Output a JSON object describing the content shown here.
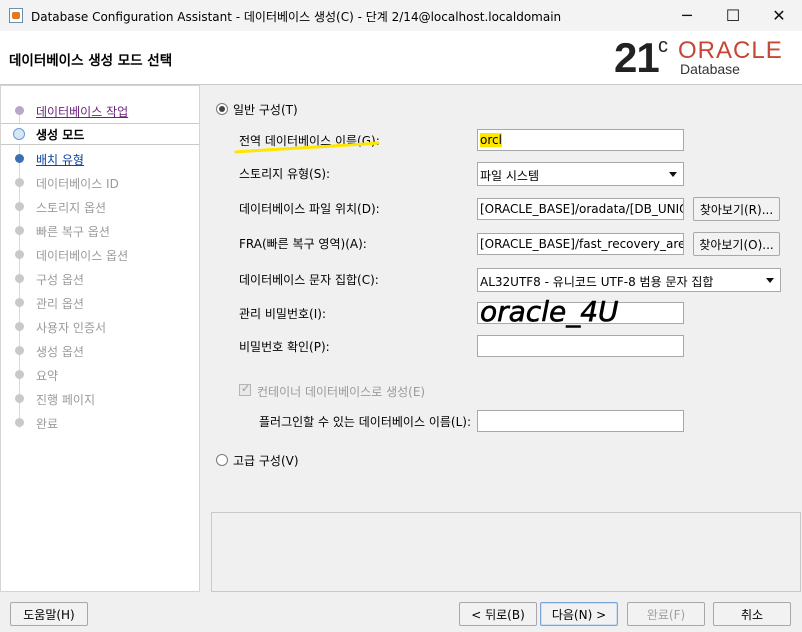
{
  "window": {
    "title": "Database Configuration Assistant - 데이터베이스 생성(C) - 단계 2/14@localhost.localdomain",
    "minimize_glyph": "─",
    "maximize_glyph": "☐",
    "close_glyph": "✕"
  },
  "header": {
    "title": "데이터베이스 생성 모드 선택",
    "logo_version": "21",
    "logo_suffix": "c",
    "logo_brand": "ORACLE",
    "logo_product": "Database"
  },
  "sidebar": {
    "steps": [
      {
        "label": "데이터베이스 작업",
        "state": "done"
      },
      {
        "label": "생성 모드",
        "state": "current"
      },
      {
        "label": "배치 유형",
        "state": "link"
      },
      {
        "label": "데이터베이스 ID",
        "state": "disabled"
      },
      {
        "label": "스토리지 옵션",
        "state": "disabled"
      },
      {
        "label": "빠른 복구 옵션",
        "state": "disabled"
      },
      {
        "label": "데이터베이스 옵션",
        "state": "disabled"
      },
      {
        "label": "구성 옵션",
        "state": "disabled"
      },
      {
        "label": "관리 옵션",
        "state": "disabled"
      },
      {
        "label": "사용자 인증서",
        "state": "disabled"
      },
      {
        "label": "생성 옵션",
        "state": "disabled"
      },
      {
        "label": "요약",
        "state": "disabled"
      },
      {
        "label": "진행 페이지",
        "state": "disabled"
      },
      {
        "label": "완료",
        "state": "disabled"
      }
    ]
  },
  "form": {
    "typical_label": "일반 구성(T)",
    "global_db_name_label": "전역 데이터베이스 이름(G):",
    "global_db_name_value": "orcl",
    "storage_type_label": "스토리지 유형(S):",
    "storage_type_value": "파일 시스템",
    "db_file_location_label": "데이터베이스 파일 위치(D):",
    "db_file_location_value": "[ORACLE_BASE]/oradata/[DB_UNIQUE_NAME]",
    "browse_db_label": "찾아보기(R)...",
    "fra_label": "FRA(빠른 복구 영역)(A):",
    "fra_value": "[ORACLE_BASE]/fast_recovery_area/[DB_UNIQUE_NAME]",
    "browse_fra_label": "찾아보기(O)...",
    "charset_label": "데이터베이스 문자 집합(C):",
    "charset_value": "AL32UTF8 - 유니코드 UTF-8 범용 문자 집합",
    "admin_password_label": "관리 비밀번호(I):",
    "admin_password_annotation": "oracle_4U",
    "confirm_password_label": "비밀번호 확인(P):",
    "container_db_label": "컨테이너 데이터베이스로 생성(E)",
    "pdb_name_label": "플러그인할 수 있는 데이터베이스 이름(L):",
    "advanced_label": "고급 구성(V)"
  },
  "buttons": {
    "help": "도움말(H)",
    "back": "< 뒤로(B)",
    "next": "다음(N) >",
    "finish": "완료(F)",
    "cancel": "취소"
  },
  "colors": {
    "oracle_red": "#c74634",
    "highlight_yellow": "#ffe600"
  }
}
